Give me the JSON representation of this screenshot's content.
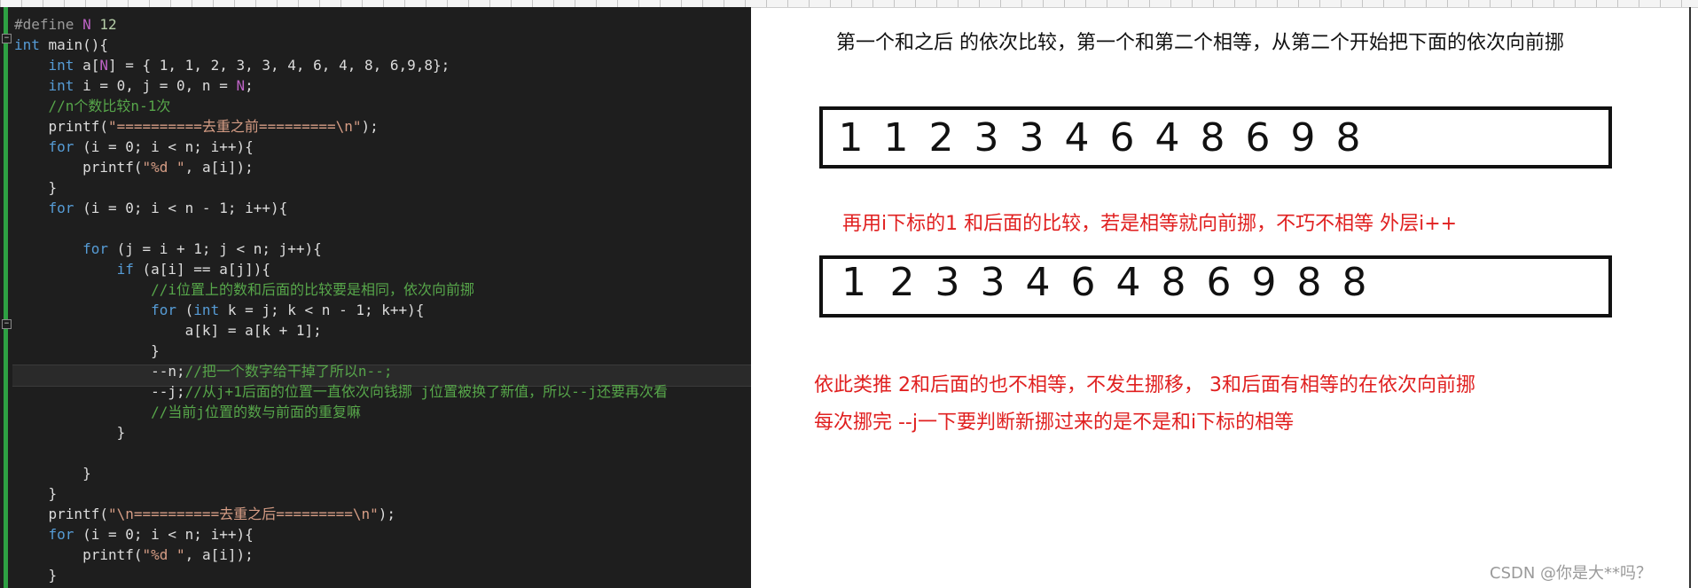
{
  "code_lines": [
    [
      [
        "pp",
        "#define "
      ],
      [
        "mac",
        "N"
      ],
      [
        "num",
        " 12"
      ]
    ],
    [
      [
        "kw",
        "int"
      ],
      [
        "p",
        " main(){"
      ]
    ],
    [
      [
        "p",
        "    "
      ],
      [
        "kw",
        "int"
      ],
      [
        "p",
        " a["
      ],
      [
        "mac",
        "N"
      ],
      [
        "p",
        "] = { 1, 1, 2, 3, 3, 4, 6, 4, 8, 6,9,8};"
      ]
    ],
    [
      [
        "p",
        "    "
      ],
      [
        "kw",
        "int"
      ],
      [
        "p",
        " i = 0, j = 0, n = "
      ],
      [
        "mac",
        "N"
      ],
      [
        "p",
        ";"
      ]
    ],
    [
      [
        "cm",
        "    //n个数比较n-1次"
      ]
    ],
    [
      [
        "p",
        "    printf("
      ],
      [
        "str",
        "\"==========去重之前=========\\n\""
      ],
      [
        "p",
        ");"
      ]
    ],
    [
      [
        "p",
        "    "
      ],
      [
        "kw",
        "for"
      ],
      [
        "p",
        " (i = 0; i < n; i++){"
      ]
    ],
    [
      [
        "p",
        "        printf("
      ],
      [
        "str",
        "\"%d \""
      ],
      [
        "p",
        ", a[i]);"
      ]
    ],
    [
      [
        "p",
        "    }"
      ]
    ],
    [
      [
        "p",
        "    "
      ],
      [
        "kw",
        "for"
      ],
      [
        "p",
        " (i = 0; i < n - 1; i++){"
      ]
    ],
    [
      [
        "p",
        ""
      ]
    ],
    [
      [
        "p",
        "        "
      ],
      [
        "kw",
        "for"
      ],
      [
        "p",
        " (j = i + 1; j < n; j++){"
      ]
    ],
    [
      [
        "p",
        "            "
      ],
      [
        "kw",
        "if"
      ],
      [
        "p",
        " (a[i] == a[j]){"
      ]
    ],
    [
      [
        "cm",
        "                //i位置上的数和后面的比较要是相同，依次向前挪"
      ]
    ],
    [
      [
        "p",
        "                "
      ],
      [
        "kw",
        "for"
      ],
      [
        "p",
        " ("
      ],
      [
        "kw",
        "int"
      ],
      [
        "p",
        " k = j; k < n - 1; k++){"
      ]
    ],
    [
      [
        "p",
        "                    a[k] = a[k + 1];"
      ]
    ],
    [
      [
        "p",
        "                }"
      ]
    ],
    [
      [
        "p",
        "                --n;"
      ],
      [
        "cm",
        "//把一个数字给干掉了所以n--;"
      ]
    ],
    [
      [
        "p",
        "                --j;"
      ],
      [
        "cm",
        "//从j+1后面的位置一直依次向钱挪 j位置被换了新值，所以--j还要再次看"
      ]
    ],
    [
      [
        "cm",
        "                //当前j位置的数与前面的重复嘛"
      ]
    ],
    [
      [
        "p",
        "            }"
      ]
    ],
    [
      [
        "p",
        ""
      ]
    ],
    [
      [
        "p",
        "        }"
      ]
    ],
    [
      [
        "p",
        "    }"
      ]
    ],
    [
      [
        "p",
        "    printf("
      ],
      [
        "str",
        "\"\\n==========去重之后=========\\n\""
      ],
      [
        "p",
        ");"
      ]
    ],
    [
      [
        "p",
        "    "
      ],
      [
        "kw",
        "for"
      ],
      [
        "p",
        " (i = 0; i < n; i++){"
      ]
    ],
    [
      [
        "p",
        "        printf("
      ],
      [
        "str",
        "\"%d \""
      ],
      [
        "p",
        ", a[i]);"
      ]
    ],
    [
      [
        "p",
        "    }"
      ]
    ]
  ],
  "notes": {
    "top": "第一个和之后 的依次比较，第一个和第二个相等，从第二个开始把下面的依次向前挪",
    "middle": "再用i下标的1 和后面的比较，若是相等就向前挪，不巧不相等 外层i++",
    "bottom_line1": "依此类推 2和后面的也不相等，不发生挪移， 3和后面有相等的在依次向前挪",
    "bottom_line2": "每次挪完 --j一下要判断新挪过来的是不是和i下标的相等"
  },
  "array_before": [
    "1",
    "1",
    "2",
    "3",
    "3",
    "4",
    "6",
    "4",
    "8",
    "6",
    "9",
    "8"
  ],
  "array_after": [
    "1",
    "2",
    "3",
    "3",
    "4",
    "6",
    "4",
    "8",
    "6",
    "9",
    "8",
    "8"
  ],
  "watermark": "CSDN @你是大**吗？",
  "colors": {
    "editor_bg": "#1e1e1e",
    "keyword": "#569cd6",
    "string": "#d69d85",
    "comment": "#57a64a",
    "macro": "#bd63c5",
    "annotation_red": "#e02020"
  }
}
